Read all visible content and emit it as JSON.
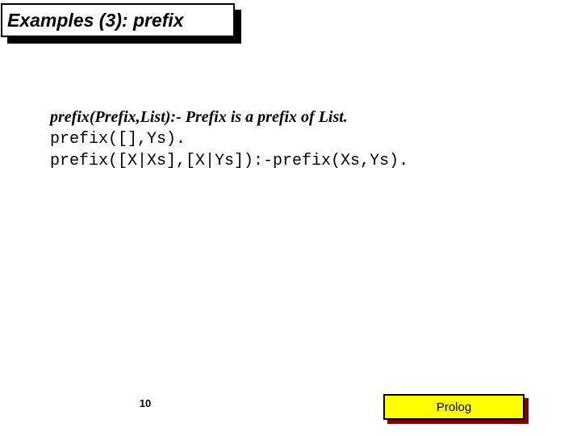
{
  "title": "Examples (3): prefix",
  "content": {
    "spec": "prefix(Prefix,List):- Prefix is a prefix of List.",
    "code1": "prefix([],Ys).",
    "code2": "prefix([X|Xs],[X|Ys]):-prefix(Xs,Ys)."
  },
  "footer": {
    "page": "10",
    "badge": "Prolog"
  }
}
